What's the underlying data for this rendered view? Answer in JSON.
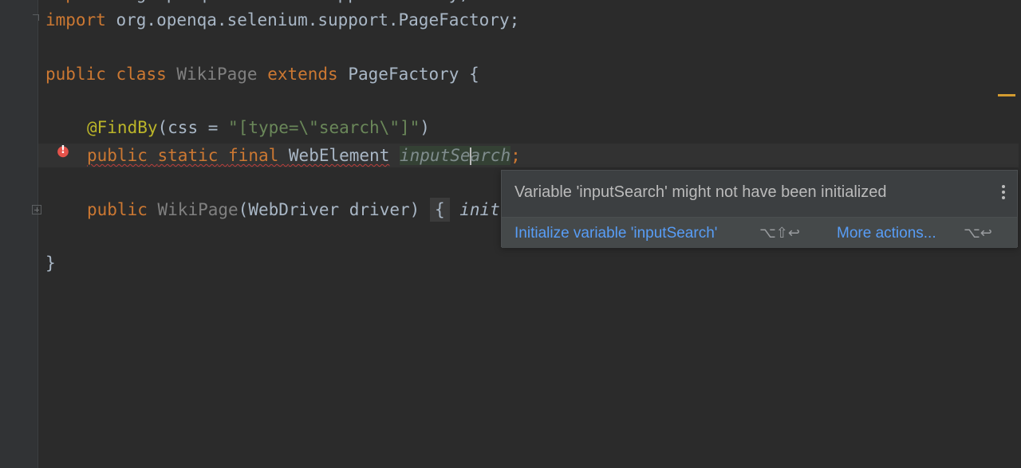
{
  "code": {
    "top_partial": "import org.openqa.selenium.support.FindBy;",
    "line1": {
      "kw": "import",
      "rest": " org.openqa.selenium.support.PageFactory;"
    },
    "line3": {
      "kw1": "public",
      "kw2": "class",
      "name": "WikiPage",
      "kw3": "extends",
      "parent": "PageFactory",
      "brace": "{"
    },
    "line5": {
      "annotation": "@FindBy",
      "open": "(css = ",
      "string": "\"[type=\\\"search\\\"]\"",
      "close": ")"
    },
    "line6": {
      "kw1": "public",
      "kw2": "static",
      "kw3": "final",
      "type": "WebElement",
      "field_a": "inputSe",
      "field_b": "arch",
      "semi": ";"
    },
    "line8": {
      "kw": "public",
      "name": "WikiPage",
      "params_open": "(",
      "ptype": "WebDriver",
      "pname": " driver",
      "params_close": ")",
      "fold": "{",
      "call": "init"
    },
    "line10": {
      "brace": "}"
    }
  },
  "popup": {
    "message": "Variable 'inputSearch' might not have been initialized",
    "primary_action": "Initialize variable 'inputSearch'",
    "primary_shortcut": "⌥⇧↩",
    "more_action": "More actions...",
    "more_shortcut": "⌥↩"
  },
  "icons": {
    "error": "error-bulb-icon",
    "menu": "more-vertical-icon"
  },
  "colors": {
    "background": "#2b2b2b",
    "keyword": "#cc7832",
    "string": "#6a8759",
    "annotation": "#bbb529",
    "link": "#589df6",
    "error": "#e5534b"
  }
}
